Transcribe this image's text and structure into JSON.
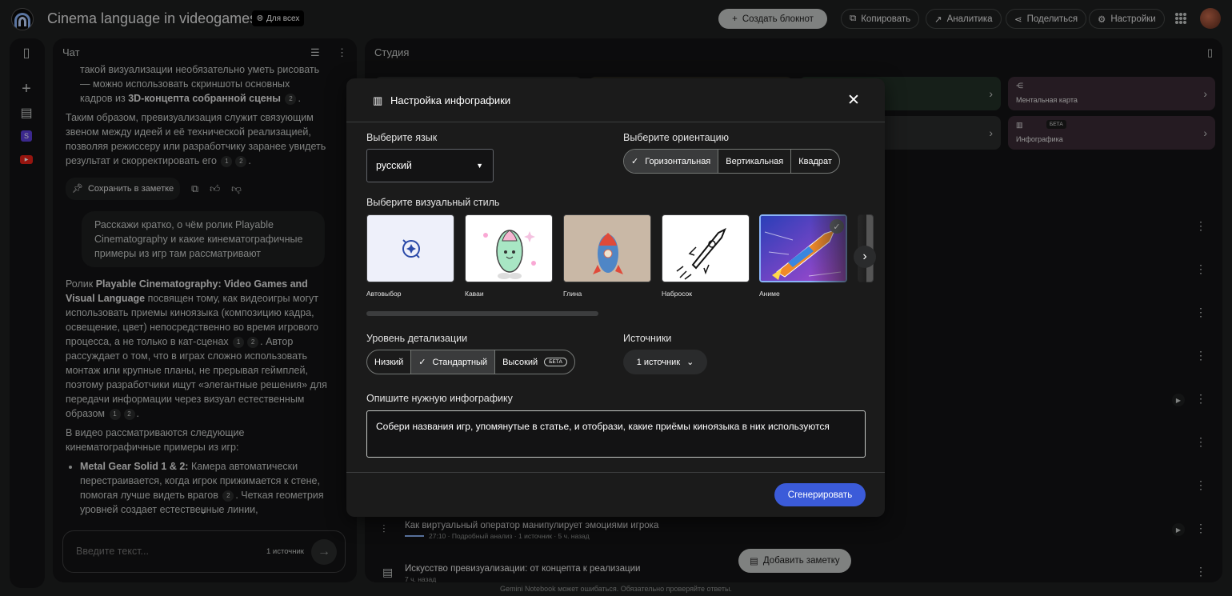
{
  "topbar": {
    "title": "Cinema language in videogames",
    "share_badge": "Для всех",
    "create_notebook": "Создать блокнот",
    "copy": "Копировать",
    "analytics": "Аналитика",
    "share": "Поделиться",
    "settings": "Настройки"
  },
  "chat": {
    "header": "Чат",
    "p0_l1": "такой визуализации необязательно уметь рисовать",
    "p0_l2": "— можно использовать скриншоты основных",
    "p0_l3_pre": "кадров из ",
    "p0_l3_bold": "3D-концепта собранной сцены",
    "p0_cite": "2",
    "p1_text": "Таким образом, превизуализация служит связующим звеном между идеей и её технической реализацией, позволяя режиссеру или разработчику заранее увидеть результат и скорректировать его",
    "cite1": "1",
    "cite2": "2",
    "save_note": "Сохранить в заметке",
    "user_msg": "Расскажи кратко, о чём ролик Playable Cinematography и какие кинематографичные примеры из игр там рассматривают",
    "a_pre": "Ролик ",
    "a_bold": "Playable Cinematography: Video Games and Visual Language",
    "a_text1": " посвящен тому, как видеоигры могут использовать приемы киноязыка (композицию кадра, освещение, цвет) непосредственно во время игрового процесса, а не только в кат-сценах",
    "a_text2": ". Автор рассуждает о том, что в играх сложно использовать монтаж или крупные планы, не прерывая геймплей, поэтому разработчики ищут «элегантные решения» для передачи информации через визуал естественным образом",
    "examples_intro": "В видео рассматриваются следующие кинематографичные примеры из игр:",
    "mgs_bold": "Metal Gear Solid 1 & 2:",
    "mgs_text1": " Камера автоматически перестраивается, когда игрок прижимается к стене, помогая лучше видеть врагов",
    "mgs_text2": ". Четкая геометрия уровней создает естественные линии,",
    "input_placeholder": "Введите текст...",
    "source_count": "1 источник"
  },
  "studio": {
    "title": "Студия",
    "card_mindmap": "Ментальная карта",
    "card_infographic": "Инфографика",
    "card_beta": "БЕТА",
    "row1_title": "Как виртуальный оператор манипулирует эмоциями игрока",
    "row1_meta": "27:10 · Подробный анализ · 1 источник · 5 ч. назад",
    "row2_title": "Искусство превизуализации: от концепта к реализации",
    "row2_meta": "7 ч. назад",
    "add_note": "Добавить заметку"
  },
  "dialog": {
    "title": "Настройка инфографики",
    "lang_label": "Выберите язык",
    "lang_value": "русский",
    "orient_label": "Выберите ориентацию",
    "orient_options": [
      "Горизонтальная",
      "Вертикальная",
      "Квадрат"
    ],
    "orient_selected": "Горизонтальная",
    "style_label": "Выберите визуальный стиль",
    "styles": [
      "Автовыбор",
      "Каваи",
      "Глина",
      "Набросок",
      "Аниме"
    ],
    "style_selected": "Аниме",
    "detail_label": "Уровень детализации",
    "detail_options": [
      "Низкий",
      "Стандартный",
      "Высокий"
    ],
    "detail_selected": "Стандартный",
    "beta": "БЕТА",
    "sources_label": "Источники",
    "sources_value": "1 источник",
    "describe_label": "Опишите нужную инфографику",
    "describe_value": "Собери названия игр, упомянутые в статье, и отобрази, какие приёмы киноязыка в них используются",
    "generate": "Сгенерировать"
  },
  "footer": "Gemini Notebook может ошибаться. Обязательно проверяйте ответы.",
  "colors": {
    "background": "#1e1f20",
    "panel": "#131314",
    "dialog": "#1b1b1b",
    "accent": "#3b5bd9",
    "mindmap_card": "#3a2a35"
  }
}
